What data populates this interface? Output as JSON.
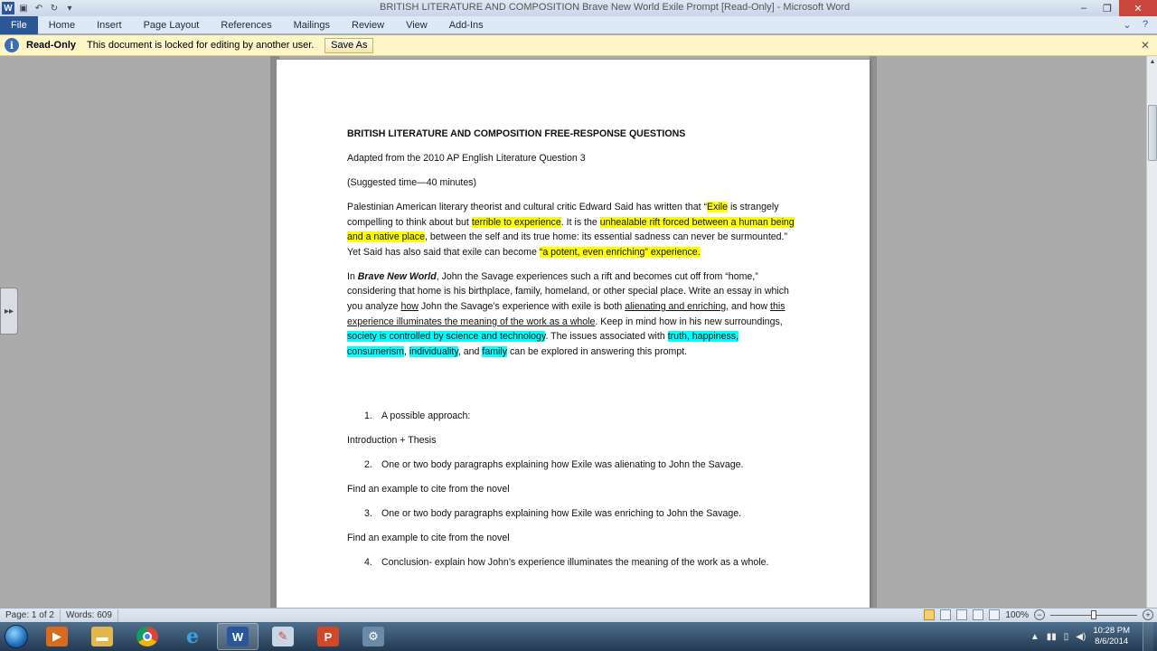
{
  "window": {
    "title": "BRITISH LITERATURE AND COMPOSITION Brave New World Exile Prompt [Read-Only] - Microsoft Word",
    "app_icon": "W",
    "minimize": "–",
    "maximize": "❐",
    "close": "✕"
  },
  "ribbon": {
    "file": "File",
    "tabs": [
      "Home",
      "Insert",
      "Page Layout",
      "References",
      "Mailings",
      "Review",
      "View",
      "Add-Ins"
    ]
  },
  "message_bar": {
    "label": "Read-Only",
    "message": "This document is locked for editing by another user.",
    "button": "Save As",
    "close": "✕"
  },
  "document": {
    "heading": "BRITISH LITERATURE AND COMPOSITION FREE-RESPONSE QUESTIONS",
    "adapted": "Adapted from the 2010  AP English Literature Question 3",
    "time": " (Suggested time—40 minutes)",
    "p1": {
      "t1": "Palestinian American literary theorist and cultural critic  Edward Said has written that “",
      "h1": "Exile",
      "t2": " is strangely compelling to think about but ",
      "h2": "terrible to experience",
      "t3": ". It is the ",
      "h3": "unhealable rift forced between a human being and a native place",
      "t4": ", between the self and its true home: its essential sadness can never be surmounted.” Yet Said has also said that exile can become ",
      "h4": "“a potent, even enriching” experience."
    },
    "p2": {
      "t1": "In ",
      "title": "Brave New World",
      "t2": ", John the Savage experiences such a rift and becomes cut off from “home,” considering that home is his birthplace, family, homeland, or other special place. Write an essay in which you analyze ",
      "u1": "how",
      "t3": " John the Savage’s experience with exile is both ",
      "u2": "alienating and enriching",
      "t4": ", and how ",
      "u3": "this experience illuminates the meaning of the work as a whole",
      "t5": ".  Keep in mind how in his new surroundings, ",
      "c1": "society is controlled by science and technology",
      "t6": ". The issues associated with ",
      "c2": "truth, happiness, consumerism",
      "t7": ", ",
      "c3": "individuality",
      "t8": ", and ",
      "c4": "family",
      "t9": " can be explored in answering this prompt."
    },
    "list": [
      {
        "num": "1.",
        "text": "A possible approach:"
      },
      {
        "num": "2.",
        "text": "One or two body paragraphs explaining how Exile was alienating to John the Savage."
      },
      {
        "num": "3.",
        "text": "One or two body paragraphs explaining how Exile was enriching to John the Savage."
      },
      {
        "num": "4.",
        "text": "Conclusion- explain how John’s experience illuminates the meaning of the work as a  whole."
      }
    ],
    "intro_thesis": "Introduction + Thesis",
    "find_example_1": "Find an example to cite from the novel",
    "find_example_2": "Find an example to cite from the novel"
  },
  "status_bar": {
    "page": "Page: 1 of 2",
    "words": "Words: 609",
    "zoom": "100%",
    "zoom_fraction": 0.5
  },
  "taskbar": {
    "apps": [
      "media-player",
      "file-explorer",
      "chrome",
      "internet-explorer",
      "word",
      "paint",
      "powerpoint",
      "tools"
    ],
    "active_app": "word",
    "time": "10:28 PM",
    "date": "8/6/2014"
  },
  "colors": {
    "highlight_yellow": "#ffff00",
    "highlight_cyan": "#00ffff",
    "file_tab": "#2b5797",
    "message_bar": "#fff6c7"
  }
}
